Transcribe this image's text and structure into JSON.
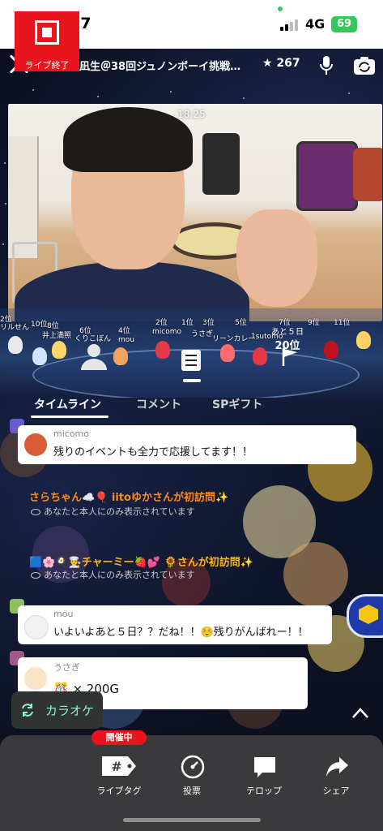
{
  "status_bar": {
    "time": "18:27",
    "network": "4G",
    "battery": "69"
  },
  "header": {
    "room_title": "大坪凪生＠38回ジュノンボーイ挑戦…",
    "star_count": "267"
  },
  "video": {
    "timestamp": "18:25"
  },
  "ranking": {
    "countdown": "あと５日",
    "rank": "20位",
    "labels": [
      "2位",
      "10位",
      "8位",
      "6位",
      "4位",
      "2位",
      "1位",
      "3位",
      "5位",
      "7位",
      "9位",
      "11位",
      "リルせん",
      "井上満照",
      "くりこぼん",
      "mou",
      "micomo",
      "うさぎ",
      "リーンカレー",
      "1sutomo"
    ]
  },
  "tabs": [
    {
      "label": "タイムライン"
    },
    {
      "label": "コメント"
    },
    {
      "label": "SPギフト"
    }
  ],
  "comments": [
    {
      "name": "micomo",
      "text": "残りのイベントも全力で応援してます！！"
    },
    {
      "name": "mou",
      "text": "いよいよあと５日？？だね！！☺️残りがんばれー！！"
    },
    {
      "name": "うさぎ",
      "text": "🎊 × 200G"
    }
  ],
  "system_messages": [
    {
      "text": "さらちゃん☁️🎈 iitoゆかさんが初訪問✨",
      "color": "#ff8a1c",
      "note": "あなたと本人にのみ表示されています"
    },
    {
      "text": "🟦🌸🍳👨‍🍳チャーミー🍓💕 🌻さんが初訪問✨",
      "color": "#ffb31a",
      "note": "あなたと本人にのみ表示されています"
    }
  ],
  "karaoke": {
    "label": "カラオケ"
  },
  "bottom_bar": {
    "badge": "開催中",
    "items": [
      {
        "label": "ライブ終了"
      },
      {
        "label": "ライブタグ"
      },
      {
        "label": "投票"
      },
      {
        "label": "テロップ"
      },
      {
        "label": "シェア"
      }
    ]
  },
  "colors": {
    "accent_red": "#e8141e",
    "karaoke_text": "#8ef0d8",
    "panel_gray": "#3a3a3c"
  }
}
